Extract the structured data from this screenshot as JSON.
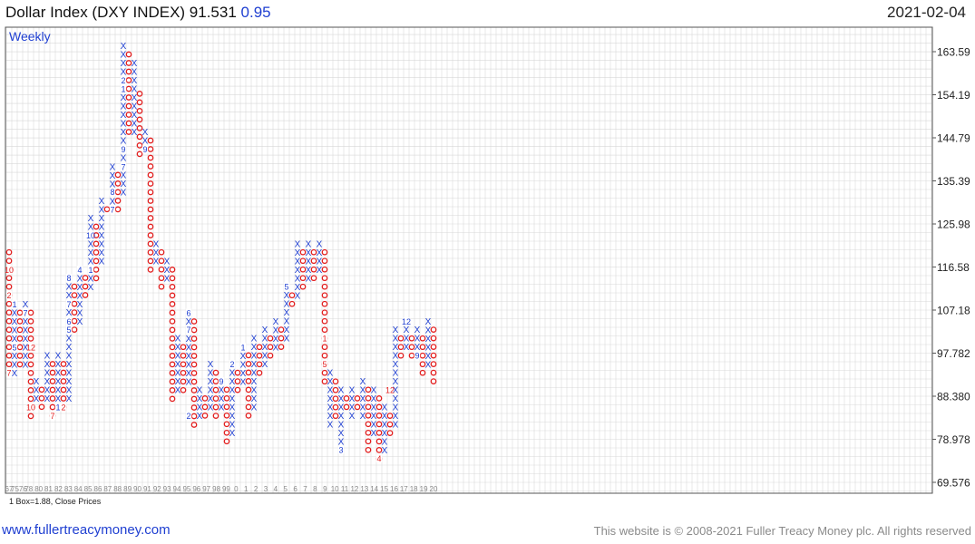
{
  "header": {
    "title": "Dollar Index (DXY INDEX) 91.531",
    "change": "0.95",
    "date": "2021-02-04"
  },
  "footer": {
    "left_link": "www.fullertreacymoney.com",
    "right_text": "This website is © 2008-2021 Fuller Treacy Money plc. All rights reserved"
  },
  "colors": {
    "x": "#1f3fd1",
    "o": "#e31d1d",
    "grid": "#d9d9d9",
    "frame": "#555555",
    "accent": "#1f3fd1"
  },
  "chart_data": {
    "type": "point-and-figure",
    "frequency_label": "Weekly",
    "box_note": "1 Box=1.88, Close Prices",
    "box_size": 1.88,
    "y_ticks": [
      "163.59",
      "154.19",
      "144.79",
      "135.39",
      "125.98",
      "116.58",
      "107.18",
      "97.782",
      "88.380",
      "78.978",
      "69.576"
    ],
    "x_labels": [
      "67",
      "7576",
      "78",
      "80",
      "81",
      "82",
      "83",
      "84",
      "85",
      "86",
      "87",
      "88",
      "89",
      "90",
      "91",
      "92",
      "93",
      "94",
      "95",
      "96",
      "97",
      "98",
      "99",
      "0",
      "1",
      "2",
      "3",
      "4",
      "5",
      "6",
      "7",
      "8",
      "9",
      "10",
      "11",
      "12",
      "13",
      "14",
      "15",
      "16",
      "17",
      "18",
      "19",
      "20"
    ],
    "columns": [
      {
        "t": "O",
        "hi": 119.8,
        "lo": 93.5
      },
      {
        "t": "X",
        "hi": 108.5,
        "lo": 93.5
      },
      {
        "t": "O",
        "hi": 106.6,
        "lo": 95.4
      },
      {
        "t": "X",
        "hi": 108.5,
        "lo": 95.4
      },
      {
        "t": "O",
        "hi": 106.6,
        "lo": 84.1
      },
      {
        "t": "X",
        "hi": 91.6,
        "lo": 87.9
      },
      {
        "t": "O",
        "hi": 89.8,
        "lo": 86.0
      },
      {
        "t": "X",
        "hi": 97.3,
        "lo": 87.9
      },
      {
        "t": "O",
        "hi": 95.4,
        "lo": 84.1
      },
      {
        "t": "X",
        "hi": 97.3,
        "lo": 86.0
      },
      {
        "t": "O",
        "hi": 95.4,
        "lo": 86.0
      },
      {
        "t": "X",
        "hi": 114.2,
        "lo": 87.9
      },
      {
        "t": "O",
        "hi": 112.3,
        "lo": 102.9
      },
      {
        "t": "X",
        "hi": 116.0,
        "lo": 104.7
      },
      {
        "t": "O",
        "hi": 114.2,
        "lo": 110.4
      },
      {
        "t": "X",
        "hi": 127.3,
        "lo": 112.3
      },
      {
        "t": "O",
        "hi": 125.4,
        "lo": 114.2
      },
      {
        "t": "X",
        "hi": 131.0,
        "lo": 117.9
      },
      {
        "t": "O",
        "hi": 129.2,
        "lo": 129.2
      },
      {
        "t": "X",
        "hi": 138.5,
        "lo": 131.0
      },
      {
        "t": "O",
        "hi": 136.7,
        "lo": 129.2
      },
      {
        "t": "X",
        "hi": 164.9,
        "lo": 133.0
      },
      {
        "t": "O",
        "hi": 163.0,
        "lo": 146.1
      },
      {
        "t": "X",
        "hi": 161.1,
        "lo": 146.1
      },
      {
        "t": "O",
        "hi": 154.4,
        "lo": 140.4
      },
      {
        "t": "X",
        "hi": 146.1,
        "lo": 142.3
      },
      {
        "t": "O",
        "hi": 144.2,
        "lo": 116.0
      },
      {
        "t": "X",
        "hi": 121.6,
        "lo": 117.9
      },
      {
        "t": "O",
        "hi": 119.8,
        "lo": 112.3
      },
      {
        "t": "X",
        "hi": 117.9,
        "lo": 114.2
      },
      {
        "t": "O",
        "hi": 116.0,
        "lo": 87.9
      },
      {
        "t": "X",
        "hi": 101.0,
        "lo": 89.8
      },
      {
        "t": "O",
        "hi": 99.1,
        "lo": 89.8
      },
      {
        "t": "X",
        "hi": 106.6,
        "lo": 91.6
      },
      {
        "t": "O",
        "hi": 104.7,
        "lo": 82.3
      },
      {
        "t": "X",
        "hi": 89.8,
        "lo": 84.1
      },
      {
        "t": "O",
        "hi": 87.9,
        "lo": 84.1
      },
      {
        "t": "X",
        "hi": 95.4,
        "lo": 86.0
      },
      {
        "t": "O",
        "hi": 93.5,
        "lo": 84.1
      },
      {
        "t": "X",
        "hi": 91.6,
        "lo": 86.0
      },
      {
        "t": "O",
        "hi": 89.8,
        "lo": 78.6
      },
      {
        "t": "X",
        "hi": 95.4,
        "lo": 80.4
      },
      {
        "t": "O",
        "hi": 93.5,
        "lo": 89.8
      },
      {
        "t": "X",
        "hi": 99.1,
        "lo": 91.6
      },
      {
        "t": "O",
        "hi": 97.3,
        "lo": 84.1
      },
      {
        "t": "X",
        "hi": 101.0,
        "lo": 86.0
      },
      {
        "t": "O",
        "hi": 99.1,
        "lo": 93.5
      },
      {
        "t": "X",
        "hi": 102.9,
        "lo": 95.4
      },
      {
        "t": "O",
        "hi": 101.0,
        "lo": 97.3
      },
      {
        "t": "X",
        "hi": 104.7,
        "lo": 99.1
      },
      {
        "t": "O",
        "hi": 102.9,
        "lo": 99.1
      },
      {
        "t": "X",
        "hi": 112.3,
        "lo": 101.0
      },
      {
        "t": "O",
        "hi": 110.4,
        "lo": 108.5
      },
      {
        "t": "X",
        "hi": 121.6,
        "lo": 110.4
      },
      {
        "t": "O",
        "hi": 119.8,
        "lo": 112.3
      },
      {
        "t": "X",
        "hi": 121.6,
        "lo": 114.2
      },
      {
        "t": "O",
        "hi": 119.8,
        "lo": 114.2
      },
      {
        "t": "X",
        "hi": 121.6,
        "lo": 116.0
      },
      {
        "t": "O",
        "hi": 119.8,
        "lo": 91.6
      },
      {
        "t": "X",
        "hi": 93.5,
        "lo": 82.3
      },
      {
        "t": "O",
        "hi": 91.6,
        "lo": 84.1
      },
      {
        "t": "X",
        "hi": 89.8,
        "lo": 76.7
      },
      {
        "t": "O",
        "hi": 87.9,
        "lo": 86.0
      },
      {
        "t": "X",
        "hi": 89.8,
        "lo": 84.1
      },
      {
        "t": "O",
        "hi": 87.9,
        "lo": 86.0
      },
      {
        "t": "X",
        "hi": 91.6,
        "lo": 84.1
      },
      {
        "t": "O",
        "hi": 89.8,
        "lo": 76.7
      },
      {
        "t": "X",
        "hi": 89.8,
        "lo": 80.4
      },
      {
        "t": "O",
        "hi": 87.9,
        "lo": 74.8
      },
      {
        "t": "X",
        "hi": 86.0,
        "lo": 76.7
      },
      {
        "t": "O",
        "hi": 84.1,
        "lo": 80.4
      },
      {
        "t": "X",
        "hi": 102.9,
        "lo": 82.3
      },
      {
        "t": "O",
        "hi": 101.0,
        "lo": 97.3
      },
      {
        "t": "X",
        "hi": 102.9,
        "lo": 99.1
      },
      {
        "t": "O",
        "hi": 101.0,
        "lo": 97.3
      },
      {
        "t": "X",
        "hi": 102.9,
        "lo": 99.1
      },
      {
        "t": "O",
        "hi": 101.0,
        "lo": 93.5
      },
      {
        "t": "X",
        "hi": 104.7,
        "lo": 95.4
      },
      {
        "t": "O",
        "hi": 102.9,
        "lo": 91.6
      }
    ],
    "annotations": [
      {
        "col": 0,
        "v": 116.0,
        "text": "10"
      },
      {
        "col": 0,
        "v": 110.4,
        "text": "2"
      },
      {
        "col": 0,
        "v": 93.5,
        "text": "7"
      },
      {
        "col": 1,
        "v": 108.5,
        "text": "1"
      },
      {
        "col": 1,
        "v": 99.1,
        "text": "5"
      },
      {
        "col": 3,
        "v": 106.6,
        "text": "7"
      },
      {
        "col": 4,
        "v": 99.1,
        "text": "12"
      },
      {
        "col": 4,
        "v": 86.0,
        "text": "10"
      },
      {
        "col": 8,
        "v": 84.1,
        "text": "7"
      },
      {
        "col": 9,
        "v": 86.0,
        "text": "1"
      },
      {
        "col": 10,
        "v": 86.0,
        "text": "2"
      },
      {
        "col": 11,
        "v": 114.2,
        "text": "8"
      },
      {
        "col": 11,
        "v": 108.5,
        "text": "7"
      },
      {
        "col": 11,
        "v": 104.7,
        "text": "6"
      },
      {
        "col": 11,
        "v": 102.9,
        "text": "5"
      },
      {
        "col": 13,
        "v": 116.0,
        "text": "4"
      },
      {
        "col": 15,
        "v": 123.5,
        "text": "10"
      },
      {
        "col": 15,
        "v": 116.0,
        "text": "1"
      },
      {
        "col": 19,
        "v": 133.0,
        "text": "8"
      },
      {
        "col": 19,
        "v": 129.2,
        "text": "7"
      },
      {
        "col": 21,
        "v": 157.4,
        "text": "2"
      },
      {
        "col": 21,
        "v": 155.5,
        "text": "1"
      },
      {
        "col": 21,
        "v": 142.3,
        "text": "9"
      },
      {
        "col": 21,
        "v": 138.5,
        "text": "7"
      },
      {
        "col": 25,
        "v": 142.3,
        "text": "9"
      },
      {
        "col": 33,
        "v": 106.6,
        "text": "6"
      },
      {
        "col": 33,
        "v": 102.9,
        "text": "7"
      },
      {
        "col": 33,
        "v": 84.1,
        "text": "2"
      },
      {
        "col": 39,
        "v": 91.6,
        "text": "9"
      },
      {
        "col": 41,
        "v": 95.4,
        "text": "2"
      },
      {
        "col": 43,
        "v": 99.1,
        "text": "1"
      },
      {
        "col": 51,
        "v": 112.3,
        "text": "5"
      },
      {
        "col": 58,
        "v": 101.0,
        "text": "1"
      },
      {
        "col": 58,
        "v": 95.4,
        "text": "5"
      },
      {
        "col": 61,
        "v": 76.7,
        "text": "3"
      },
      {
        "col": 68,
        "v": 74.8,
        "text": "4"
      },
      {
        "col": 70,
        "v": 89.8,
        "text": "12"
      },
      {
        "col": 73,
        "v": 104.7,
        "text": "12"
      },
      {
        "col": 75,
        "v": 97.3,
        "text": "9"
      }
    ]
  }
}
